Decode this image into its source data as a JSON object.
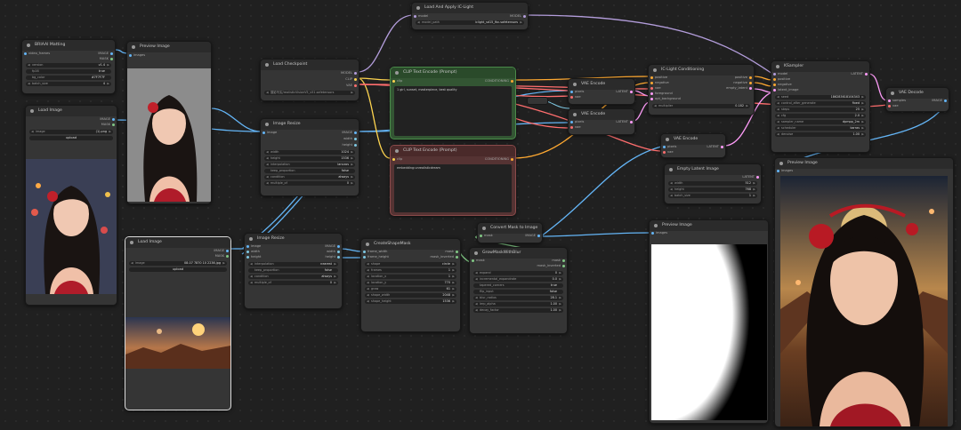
{
  "colors": {
    "image": "#64b5f6",
    "mask": "#81c784",
    "model": "#b39ddb",
    "clip": "#ffd54f",
    "vae": "#ff6e6e",
    "conditioning": "#ffa931",
    "latent": "#ff9cf9",
    "int": "#7ec8e3"
  },
  "rmbg": {
    "title": "BRIAAI Matting",
    "in_images": "video_frames",
    "out_image": "IMAGE",
    "out_mask": "MASK",
    "w_version": {
      "label": "version",
      "value": "v1.4"
    },
    "w_fp16": {
      "label": "fp16",
      "value": "true"
    },
    "w_bg_color": {
      "label": "bg_color",
      "value": "#7F7F7F"
    },
    "w_batch_size": {
      "label": "batch_size",
      "value": "4"
    }
  },
  "preview1": {
    "title": "Preview Image",
    "in_images": "images"
  },
  "loadimg1": {
    "title": "Load Image",
    "out_image": "IMAGE",
    "out_mask": "MASK",
    "w_image": {
      "label": "image",
      "value": "(1).png"
    },
    "upload": "upload"
  },
  "loadimg2": {
    "title": "Load Image",
    "out_image": "IMAGE",
    "out_mask": "MASK",
    "w_image": {
      "label": "image",
      "value": "08-07 7870 10 2236.jpg"
    },
    "upload": "upload"
  },
  "ckpt": {
    "title": "Load Checkpoint",
    "out_model": "MODEL",
    "out_clip": "CLIP",
    "out_vae": "VAE",
    "w_ckpt": {
      "label": "",
      "value": "摄影写实/realisticVisionV5_v51.safetensors"
    }
  },
  "iclight": {
    "title": "Load And Apply IC-Light",
    "in_model": "model",
    "out_model": "MODEL",
    "w_model_path": {
      "label": "model_path",
      "value": "iclight_sd15_fbc.safetensors"
    }
  },
  "clip_pos": {
    "title": "CLIP Text Encode (Prompt)",
    "in_clip": "clip",
    "out": "CONDITIONING",
    "text": "1 girl, sunset, masterpiece, best quality"
  },
  "clip_neg": {
    "title": "CLIP Text Encode (Prompt)",
    "in_clip": "clip",
    "out": "CONDITIONING",
    "text": "embedding:unrealisticdream"
  },
  "resize1": {
    "title": "Image Resize",
    "in_image": "image",
    "out_image": "IMAGE",
    "out_width": "width",
    "out_height": "height",
    "w_width": {
      "label": "width",
      "value": "1024"
    },
    "w_height": {
      "label": "height",
      "value": "1536"
    },
    "w_interp": {
      "label": "interpolation",
      "value": "lanczos"
    },
    "w_keep": {
      "label": "keep_proportion",
      "value": "false"
    },
    "w_cond": {
      "label": "condition",
      "value": "always"
    },
    "w_mult": {
      "label": "multiple_of",
      "value": "0"
    }
  },
  "resize2": {
    "title": "Image Resize",
    "in_image": "image",
    "in_width": "width",
    "in_height": "height",
    "out_image": "IMAGE",
    "out_width": "width",
    "out_height": "height",
    "w_interp": {
      "label": "interpolation",
      "value": "nearest"
    },
    "w_keep": {
      "label": "keep_proportion",
      "value": "false"
    },
    "w_cond": {
      "label": "condition",
      "value": "always"
    },
    "w_mult": {
      "label": "multiple_of",
      "value": "0"
    }
  },
  "vae_enc1": {
    "title": "VAE Encode",
    "in_pixels": "pixels",
    "in_vae": "vae",
    "out": "LATENT"
  },
  "vae_enc2": {
    "title": "VAE Encode",
    "in_pixels": "pixels",
    "in_vae": "vae",
    "out": "LATENT"
  },
  "vae_enc3": {
    "title": "VAE Encode",
    "in_pixels": "pixels",
    "in_vae": "vae",
    "out": "LATENT"
  },
  "iccond": {
    "title": "IC-Light Conditioning",
    "in_positive": "positive",
    "in_negative": "negative",
    "in_vae": "vae",
    "in_foreground": "foreground",
    "in_opt_background": "opt_background",
    "out_positive": "positive",
    "out_negative": "negative",
    "out_empty": "empty_latent",
    "w_mult": {
      "label": "multiplier",
      "value": "0.182"
    }
  },
  "ksampler": {
    "title": "KSampler",
    "in_model": "model",
    "in_positive": "positive",
    "in_negative": "negative",
    "in_latent": "latent_image",
    "out": "LATENT",
    "w_seed": {
      "label": "seed",
      "value": "186283618104343"
    },
    "w_ctrl": {
      "label": "control_after_generate",
      "value": "fixed"
    },
    "w_steps": {
      "label": "steps",
      "value": "25"
    },
    "w_cfg": {
      "label": "cfg",
      "value": "2.0"
    },
    "w_sampler": {
      "label": "sampler_name",
      "value": "dpmpp_2m"
    },
    "w_sched": {
      "label": "scheduler",
      "value": "karras"
    },
    "w_denoise": {
      "label": "denoise",
      "value": "1.00"
    }
  },
  "vae_dec": {
    "title": "VAE Decode",
    "in_samples": "samples",
    "in_vae": "vae",
    "out": "IMAGE"
  },
  "empty_latent": {
    "title": "Empty Latent Image",
    "out": "LATENT",
    "w_width": {
      "label": "width",
      "value": "512"
    },
    "w_height": {
      "label": "height",
      "value": "768"
    },
    "w_batch": {
      "label": "batch_size",
      "value": "1"
    }
  },
  "preview_final": {
    "title": "Preview Image",
    "in_images": "images"
  },
  "preview_mask": {
    "title": "Preview Image",
    "in_images": "images"
  },
  "mask2img": {
    "title": "Convert Mask to Image",
    "in_mask": "mask",
    "out": "IMAGE"
  },
  "shape": {
    "title": "CreateShapeMask",
    "in_frame_width": "frame_width",
    "in_frame_height": "frame_height",
    "out_mask": "mask",
    "out_inv": "mask_inverted",
    "w_shape": {
      "label": "shape",
      "value": "circle"
    },
    "w_frames": {
      "label": "frames",
      "value": "1"
    },
    "w_x": {
      "label": "location_x",
      "value": "1"
    },
    "w_y": {
      "label": "location_y",
      "value": "770"
    },
    "w_grow": {
      "label": "grow",
      "value": "61"
    },
    "w_sw": {
      "label": "shape_width",
      "value": "2048"
    },
    "w_sh": {
      "label": "shape_height",
      "value": "1536"
    }
  },
  "grow": {
    "title": "GrowMaskWithBlur",
    "in_mask": "mask",
    "out_mask": "mask",
    "out_inv": "mask_inverted",
    "w_expand": {
      "label": "expand",
      "value": "0"
    },
    "w_incr": {
      "label": "incremental_expandrate",
      "value": "0.0"
    },
    "w_taper": {
      "label": "tapered_corners",
      "value": "true"
    },
    "w_flip": {
      "label": "flip_input",
      "value": "false"
    },
    "w_blur": {
      "label": "blur_radius",
      "value": "28.1"
    },
    "w_lerp": {
      "label": "lerp_alpha",
      "value": "1.00"
    },
    "w_decay": {
      "label": "decay_factor",
      "value": "1.00"
    }
  }
}
